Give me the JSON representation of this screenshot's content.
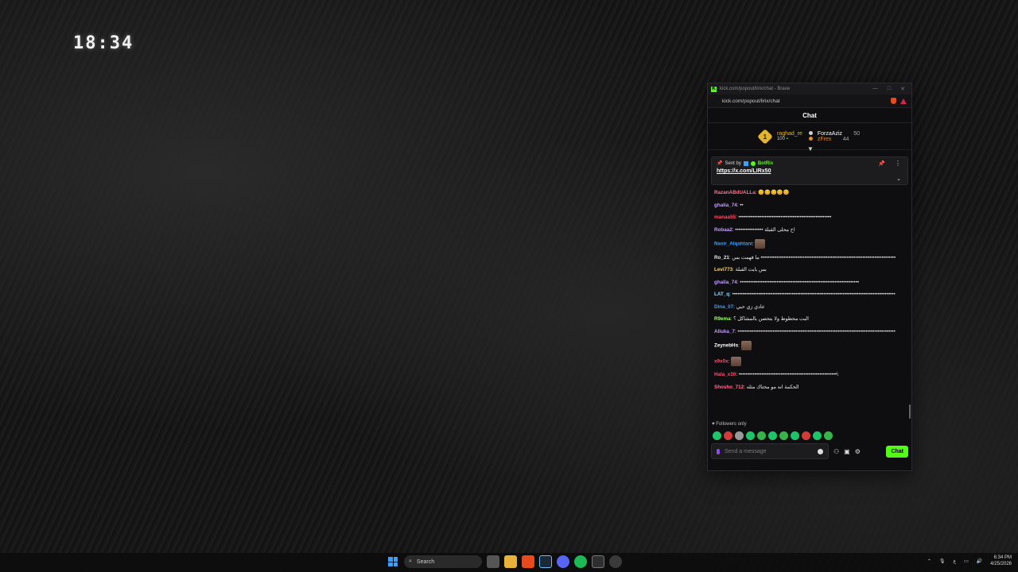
{
  "desktop": {
    "clock": "18:34"
  },
  "browser": {
    "title": "kick.com/popout/lirix/chat - Brave",
    "url": "kick.com/popout/lirix/chat"
  },
  "chat": {
    "header": "Chat",
    "leaderboard": {
      "first": {
        "rank": "1",
        "name": "raghad_re",
        "amount": "100"
      },
      "second": {
        "name": "ForzaAziz",
        "amount": "50"
      },
      "third": {
        "name": "zFrex",
        "amount": "44"
      }
    },
    "pinned": {
      "sent_by_label": "Sent by",
      "bot_name": "BotRix",
      "link": "https://x.com/LIRx50"
    },
    "messages": [
      {
        "user": "RazanABdUALLa",
        "color": "#ff6f91",
        "text": "😊😊😊😊😊"
      },
      {
        "user": "ghalia_74",
        "color": "#c39bff",
        "text": "••"
      },
      {
        "user": "manaa55",
        "color": "#ff4d6d",
        "text": "•••••••••••••••••••••••••••••••••••••••••••••••••••••"
      },
      {
        "user": "Robaa2",
        "color": "#c39bff",
        "text": "•••••••••••••••• اخ محلى القبلة"
      },
      {
        "user": "Nasir_Alqahtani",
        "color": "#3aa0ff",
        "text": ""
      },
      {
        "user": "Ro_21",
        "color": "#e6e6e6",
        "text": "ما فهمت بس •••••••••••••••••••••••••••••••••••••••••••••••••••••••••••••••••••••••••••••"
      },
      {
        "user": "Levi773",
        "color": "#f5d76e",
        "text": "بس بايت القبلة"
      },
      {
        "user": "ghalia_74",
        "color": "#c39bff",
        "text": "••••••••••••••••••••••••••••••••••••••••••••••••••••••••••••••••••••"
      },
      {
        "user": "LAT_q",
        "color": "#7be0ff",
        "text": "•••••••••••••••••••••••••••••••••••••••••••••••••••••••••••••••••••••••••••••••••••••••••••••"
      },
      {
        "user": "Dina_07",
        "color": "#3aa0ff",
        "text": "عادي زي حبي"
      },
      {
        "user": "R9ema",
        "color": "#9bff6a",
        "text": "البت محظوظ ولا بتحضن بالمشاكل ؟"
      },
      {
        "user": "Alluka_7",
        "color": "#c39bff",
        "text": "••••••••••••••••••••••••••••••••••••••••••••••••••••••••••••••••••••••••••••••••••••••••••"
      },
      {
        "user": "ZeynebHs",
        "color": "#ffffff",
        "text": ""
      },
      {
        "user": "x9x0x",
        "color": "#ff4d6d",
        "text": ""
      },
      {
        "user": "Hala_x30",
        "color": "#ff4d6d",
        "text": "••••••••••••••••••••••••••••••••••••••••••••••••••••••••\\"
      },
      {
        "user": "Shosho_712",
        "color": "#ff6f91",
        "text": "الحكمة انه مو محتاك مثله"
      }
    ],
    "followers_only": "Followers only",
    "input_placeholder": "Send a message",
    "send_label": "Chat"
  },
  "taskbar": {
    "search_label": "Search",
    "time": "6:34 PM",
    "date": "4/25/2026"
  },
  "colors": {
    "kick_green": "#53fc18",
    "gold": "#e3b52c"
  }
}
